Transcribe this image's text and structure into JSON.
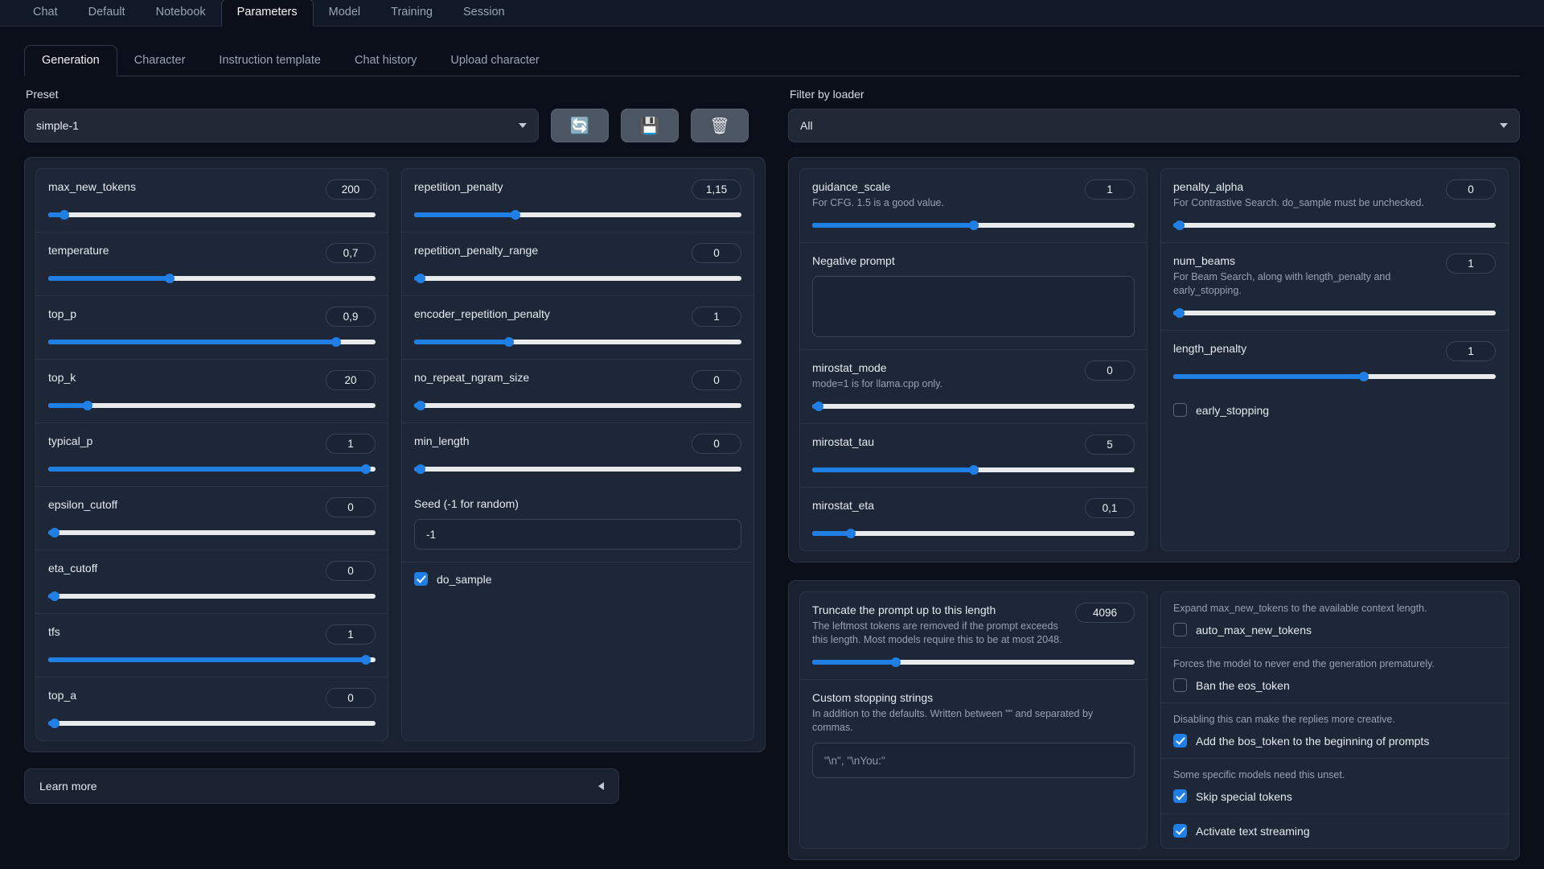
{
  "top_tabs": [
    {
      "label": "Chat",
      "active": false
    },
    {
      "label": "Default",
      "active": false
    },
    {
      "label": "Notebook",
      "active": false
    },
    {
      "label": "Parameters",
      "active": true
    },
    {
      "label": "Model",
      "active": false
    },
    {
      "label": "Training",
      "active": false
    },
    {
      "label": "Session",
      "active": false
    }
  ],
  "sub_tabs": [
    {
      "label": "Generation",
      "active": true
    },
    {
      "label": "Character",
      "active": false
    },
    {
      "label": "Instruction template",
      "active": false
    },
    {
      "label": "Chat history",
      "active": false
    },
    {
      "label": "Upload character",
      "active": false
    }
  ],
  "preset": {
    "label": "Preset",
    "value": "simple-1",
    "refresh_icon": "refresh-icon",
    "save_icon": "floppy-disk-icon",
    "delete_icon": "trash-icon"
  },
  "filter": {
    "label": "Filter by loader",
    "value": "All"
  },
  "column1": [
    {
      "name": "max_new_tokens",
      "value": "200",
      "pct": 5
    },
    {
      "name": "temperature",
      "value": "0,7",
      "pct": 37
    },
    {
      "name": "top_p",
      "value": "0,9",
      "pct": 88
    },
    {
      "name": "top_k",
      "value": "20",
      "pct": 12
    },
    {
      "name": "typical_p",
      "value": "1",
      "pct": 97
    },
    {
      "name": "epsilon_cutoff",
      "value": "0",
      "pct": 2
    },
    {
      "name": "eta_cutoff",
      "value": "0",
      "pct": 2
    },
    {
      "name": "tfs",
      "value": "1",
      "pct": 97
    },
    {
      "name": "top_a",
      "value": "0",
      "pct": 2
    }
  ],
  "column2": [
    {
      "name": "repetition_penalty",
      "value": "1,15",
      "pct": 31
    },
    {
      "name": "repetition_penalty_range",
      "value": "0",
      "pct": 2
    },
    {
      "name": "encoder_repetition_penalty",
      "value": "1",
      "pct": 29
    },
    {
      "name": "no_repeat_ngram_size",
      "value": "0",
      "pct": 2
    },
    {
      "name": "min_length",
      "value": "0",
      "pct": 2
    }
  ],
  "seed": {
    "label": "Seed (-1 for random)",
    "value": "-1"
  },
  "do_sample": {
    "label": "do_sample",
    "checked": true
  },
  "column3": [
    {
      "name": "guidance_scale",
      "info": "For CFG. 1.5 is a good value.",
      "value": "1",
      "pct": 50
    },
    {
      "name": "mirostat_mode",
      "info": "mode=1 is for llama.cpp only.",
      "value": "0",
      "pct": 2
    },
    {
      "name": "mirostat_tau",
      "info": "",
      "value": "5",
      "pct": 50
    },
    {
      "name": "mirostat_eta",
      "info": "",
      "value": "0,1",
      "pct": 12
    }
  ],
  "negative_prompt": {
    "label": "Negative prompt",
    "value": ""
  },
  "column4": [
    {
      "name": "penalty_alpha",
      "info": "For Contrastive Search. do_sample must be unchecked.",
      "value": "0",
      "pct": 2
    },
    {
      "name": "num_beams",
      "info": "For Beam Search, along with length_penalty and early_stopping.",
      "value": "1",
      "pct": 2
    },
    {
      "name": "length_penalty",
      "info": "",
      "value": "1",
      "pct": 59
    }
  ],
  "early_stopping": {
    "label": "early_stopping",
    "checked": false
  },
  "truncate": {
    "name": "Truncate the prompt up to this length",
    "info": "The leftmost tokens are removed if the prompt exceeds this length. Most models require this to be at most 2048.",
    "value": "4096",
    "pct": 26
  },
  "custom_stopping": {
    "name": "Custom stopping strings",
    "info": "In addition to the defaults. Written between \"\" and separated by commas.",
    "placeholder": "\"\\n\", \"\\nYou:\""
  },
  "right_checks": [
    {
      "hint": "Expand max_new_tokens to the available context length.",
      "label": "auto_max_new_tokens",
      "checked": false
    },
    {
      "hint": "Forces the model to never end the generation prematurely.",
      "label": "Ban the eos_token",
      "checked": false
    },
    {
      "hint": "Disabling this can make the replies more creative.",
      "label": "Add the bos_token to the beginning of prompts",
      "checked": true
    },
    {
      "hint": "Some specific models need this unset.",
      "label": "Skip special tokens",
      "checked": true
    },
    {
      "hint": "",
      "label": "Activate text streaming",
      "checked": true
    }
  ],
  "learn_more": {
    "label": "Learn more",
    "arrow": "triangle-left-icon"
  },
  "colors": {
    "accent": "#1f7fe5",
    "background": "#0b0f19",
    "panel": "#1a2232",
    "card": "#1e2738"
  }
}
